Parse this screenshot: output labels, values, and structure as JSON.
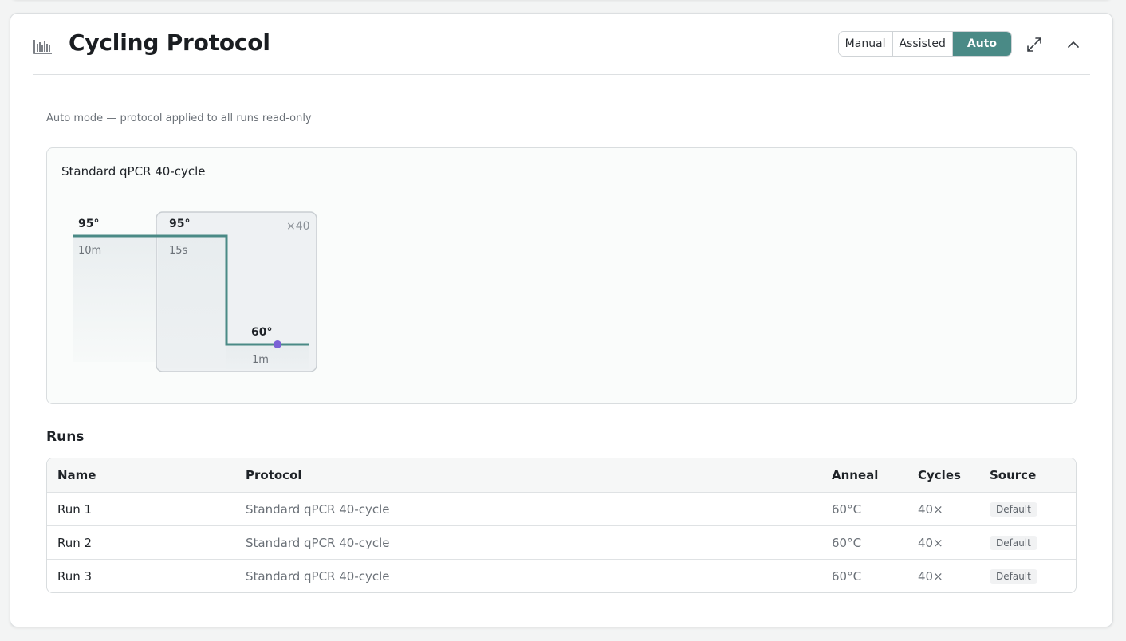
{
  "header": {
    "title": "Cycling Protocol",
    "modes": [
      "Manual",
      "Assisted",
      "Auto"
    ],
    "active_mode": "Auto",
    "icon": "bar-chart-icon"
  },
  "subtitle": "Auto mode — protocol applied to all runs read-only",
  "protocol": {
    "name": "Standard qPCR 40-cycle",
    "steps": [
      {
        "temp": "95°",
        "time": "10m"
      },
      {
        "temp": "95°",
        "time": "15s"
      },
      {
        "temp": "60°",
        "time": "1m"
      }
    ],
    "cycle_label": "×40"
  },
  "runs": {
    "title": "Runs",
    "columns": [
      "Name",
      "Protocol",
      "Anneal",
      "Cycles",
      "Source"
    ],
    "rows": [
      {
        "name": "Run 1",
        "protocol": "Standard qPCR 40-cycle",
        "anneal": "60°C",
        "cycles": "40×",
        "source": "Default"
      },
      {
        "name": "Run 2",
        "protocol": "Standard qPCR 40-cycle",
        "anneal": "60°C",
        "cycles": "40×",
        "source": "Default"
      },
      {
        "name": "Run 3",
        "protocol": "Standard qPCR 40-cycle",
        "anneal": "60°C",
        "cycles": "40×",
        "source": "Default"
      }
    ]
  },
  "colors": {
    "accent": "#4a8a86",
    "marker": "#7b62d6"
  }
}
